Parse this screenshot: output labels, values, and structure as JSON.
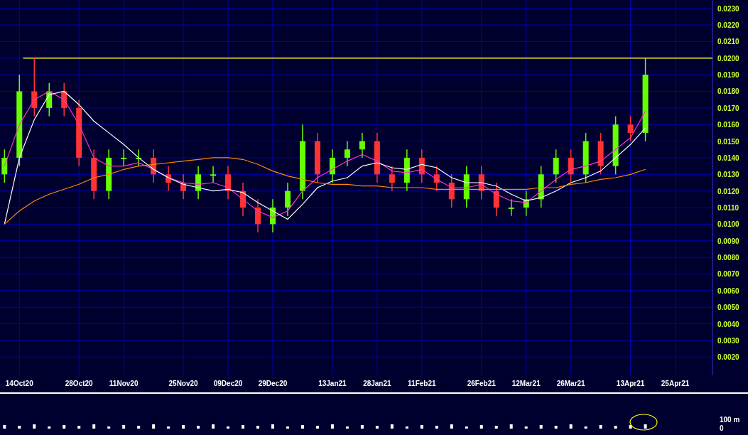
{
  "price_panel": {
    "chart_data": {
      "type": "candlestick",
      "grid": true,
      "ohlc": [
        [
          0.013,
          0.0145,
          0.0125,
          0.014
        ],
        [
          0.014,
          0.019,
          0.0135,
          0.018
        ],
        [
          0.018,
          0.02,
          0.0165,
          0.017
        ],
        [
          0.017,
          0.0185,
          0.0165,
          0.018
        ],
        [
          0.018,
          0.0185,
          0.0165,
          0.017
        ],
        [
          0.017,
          0.0175,
          0.0135,
          0.014
        ],
        [
          0.014,
          0.0145,
          0.0115,
          0.012
        ],
        [
          0.012,
          0.0145,
          0.0115,
          0.014
        ],
        [
          0.014,
          0.0145,
          0.0135,
          0.014
        ],
        [
          0.014,
          0.0145,
          0.0135,
          0.014
        ],
        [
          0.014,
          0.0145,
          0.0125,
          0.013
        ],
        [
          0.013,
          0.0135,
          0.012,
          0.0125
        ],
        [
          0.0125,
          0.013,
          0.0115,
          0.012
        ],
        [
          0.012,
          0.0135,
          0.0115,
          0.013
        ],
        [
          0.013,
          0.0135,
          0.0125,
          0.013
        ],
        [
          0.013,
          0.0135,
          0.0115,
          0.012
        ],
        [
          0.012,
          0.0125,
          0.0105,
          0.011
        ],
        [
          0.011,
          0.0115,
          0.0095,
          0.01
        ],
        [
          0.01,
          0.0115,
          0.0095,
          0.011
        ],
        [
          0.011,
          0.0125,
          0.0105,
          0.012
        ],
        [
          0.012,
          0.016,
          0.0115,
          0.015
        ],
        [
          0.015,
          0.0155,
          0.0125,
          0.013
        ],
        [
          0.013,
          0.0145,
          0.0125,
          0.014
        ],
        [
          0.014,
          0.015,
          0.0135,
          0.0145
        ],
        [
          0.0145,
          0.0155,
          0.014,
          0.015
        ],
        [
          0.015,
          0.0155,
          0.0125,
          0.013
        ],
        [
          0.013,
          0.0135,
          0.012,
          0.0125
        ],
        [
          0.0125,
          0.0145,
          0.012,
          0.014
        ],
        [
          0.014,
          0.0145,
          0.0125,
          0.013
        ],
        [
          0.013,
          0.0135,
          0.012,
          0.0125
        ],
        [
          0.0125,
          0.013,
          0.011,
          0.0115
        ],
        [
          0.0115,
          0.0135,
          0.011,
          0.013
        ],
        [
          0.013,
          0.0135,
          0.0115,
          0.012
        ],
        [
          0.012,
          0.0125,
          0.0105,
          0.011
        ],
        [
          0.011,
          0.0115,
          0.0105,
          0.011
        ],
        [
          0.011,
          0.012,
          0.0105,
          0.0115
        ],
        [
          0.0115,
          0.0135,
          0.011,
          0.013
        ],
        [
          0.013,
          0.0145,
          0.0125,
          0.014
        ],
        [
          0.014,
          0.0145,
          0.0125,
          0.013
        ],
        [
          0.013,
          0.0155,
          0.0125,
          0.015
        ],
        [
          0.015,
          0.0155,
          0.013,
          0.0135
        ],
        [
          0.0135,
          0.0165,
          0.013,
          0.016
        ],
        [
          0.016,
          0.0165,
          0.015,
          0.0155
        ],
        [
          0.0155,
          0.02,
          0.015,
          0.019
        ],
        null,
        null
      ],
      "categories": [
        null,
        "14Oct20",
        null,
        null,
        null,
        "28Oct20",
        null,
        null,
        "11Nov20",
        null,
        null,
        null,
        "25Nov20",
        null,
        null,
        "09Dec20",
        null,
        null,
        "29Dec20",
        null,
        null,
        null,
        "13Jan21",
        null,
        null,
        "28Jan21",
        null,
        null,
        "11Feb21",
        null,
        null,
        null,
        "26Feb21",
        null,
        null,
        "12Mar21",
        null,
        null,
        "26Mar21",
        null,
        null,
        null,
        "13Apr21",
        null,
        null,
        "25Apr21"
      ],
      "series": [
        {
          "type": "line",
          "color": "#ff33cc",
          "values": [
            0.0135,
            0.016,
            0.0175,
            0.018,
            0.0175,
            0.016,
            0.014,
            0.0135,
            0.0135,
            0.0137,
            0.0133,
            0.0128,
            0.0125,
            0.0124,
            0.0125,
            0.0122,
            0.0115,
            0.0108,
            0.0104,
            0.0108,
            0.012,
            0.0128,
            0.0133,
            0.0138,
            0.0142,
            0.0138,
            0.0132,
            0.0131,
            0.0133,
            0.0127,
            0.0122,
            0.0122,
            0.0124,
            0.0118,
            0.0114,
            0.0113,
            0.012,
            0.0127,
            0.0133,
            0.0135,
            0.0138,
            0.0145,
            0.0152,
            0.0168,
            null,
            null
          ]
        },
        {
          "type": "line",
          "color": "#ffffff",
          "values": [
            0.01,
            0.014,
            0.0163,
            0.0178,
            0.018,
            0.0172,
            0.0162,
            0.0155,
            0.0148,
            0.014,
            0.0133,
            0.0128,
            0.0124,
            0.0122,
            0.012,
            0.0121,
            0.0119,
            0.0113,
            0.0108,
            0.0103,
            0.0112,
            0.0122,
            0.0126,
            0.0128,
            0.0135,
            0.0137,
            0.0134,
            0.0133,
            0.0136,
            0.0134,
            0.0128,
            0.0125,
            0.0125,
            0.0123,
            0.0118,
            0.0114,
            0.0116,
            0.012,
            0.0125,
            0.0128,
            0.0132,
            0.014,
            0.0148,
            0.0158,
            null,
            null
          ]
        },
        {
          "type": "line",
          "color": "#ff8800",
          "values": [
            0.01,
            0.0108,
            0.0114,
            0.0118,
            0.0121,
            0.0124,
            0.0128,
            0.013,
            0.0133,
            0.0135,
            0.0136,
            0.0137,
            0.0138,
            0.0139,
            0.014,
            0.014,
            0.0139,
            0.0136,
            0.0132,
            0.0129,
            0.0127,
            0.0125,
            0.0124,
            0.0124,
            0.0123,
            0.0123,
            0.0122,
            0.0122,
            0.0122,
            0.0121,
            0.0121,
            0.0121,
            0.0121,
            0.0121,
            0.0121,
            0.0121,
            0.0122,
            0.0122,
            0.0124,
            0.0125,
            0.0127,
            0.0128,
            0.013,
            0.0133,
            null,
            null
          ]
        }
      ],
      "ylim": [
        0.0009,
        0.0235
      ],
      "yticks": [
        {
          "value": 0.002,
          "label": "0.0020"
        },
        {
          "value": 0.003,
          "label": "0.0030"
        },
        {
          "value": 0.004,
          "label": "0.0040"
        },
        {
          "value": 0.005,
          "label": "0.0050"
        },
        {
          "value": 0.006,
          "label": "0.0060"
        },
        {
          "value": 0.007,
          "label": "0.0070"
        },
        {
          "value": 0.008,
          "label": "0.0080"
        },
        {
          "value": 0.009,
          "label": "0.0090"
        },
        {
          "value": 0.01,
          "label": "0.0100"
        },
        {
          "value": 0.011,
          "label": "0.0110"
        },
        {
          "value": 0.012,
          "label": "0.0120"
        },
        {
          "value": 0.013,
          "label": "0.0130"
        },
        {
          "value": 0.014,
          "label": "0.0140"
        },
        {
          "value": 0.015,
          "label": "0.0150"
        },
        {
          "value": 0.016,
          "label": "0.0160"
        },
        {
          "value": 0.017,
          "label": "0.0170"
        },
        {
          "value": 0.018,
          "label": "0.0180"
        },
        {
          "value": 0.019,
          "label": "0.0190"
        },
        {
          "value": 0.02,
          "label": "0.0200"
        },
        {
          "value": 0.021,
          "label": "0.0210"
        },
        {
          "value": 0.022,
          "label": "0.0220"
        },
        {
          "value": 0.023,
          "label": "0.0230"
        }
      ],
      "ref_lines": [
        {
          "axis": "y",
          "value": 0.02
        }
      ]
    }
  },
  "volume_panel": {
    "labels": [
      "100 m",
      "0"
    ],
    "highlight": {
      "kind": "ellipse",
      "color": "#ffff00"
    }
  }
}
